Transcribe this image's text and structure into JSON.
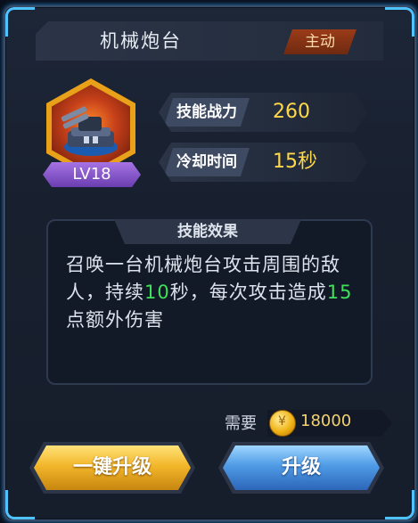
{
  "skill": {
    "name": "机械炮台",
    "type_badge": "主动",
    "level": "LV18",
    "icon": "turret-icon"
  },
  "stats": [
    {
      "label": "技能战力",
      "value": "260"
    },
    {
      "label": "冷却时间",
      "value": "15秒"
    }
  ],
  "effect": {
    "heading": "技能效果",
    "text_part1": "召唤一台机械炮台攻击周围的敌人，持续",
    "duration": "10",
    "text_part2": "秒，每次攻击造成",
    "damage": "15",
    "text_part3": "点额外伤害"
  },
  "cost": {
    "label": "需要",
    "amount": "18000",
    "icon": "gold-coin-icon"
  },
  "buttons": {
    "upgrade_all": "一键升级",
    "upgrade": "升级"
  },
  "colors": {
    "highlight_green": "#3fe05a",
    "stat_yellow": "#ffd84a",
    "accent_blue": "#4fc3ff"
  }
}
